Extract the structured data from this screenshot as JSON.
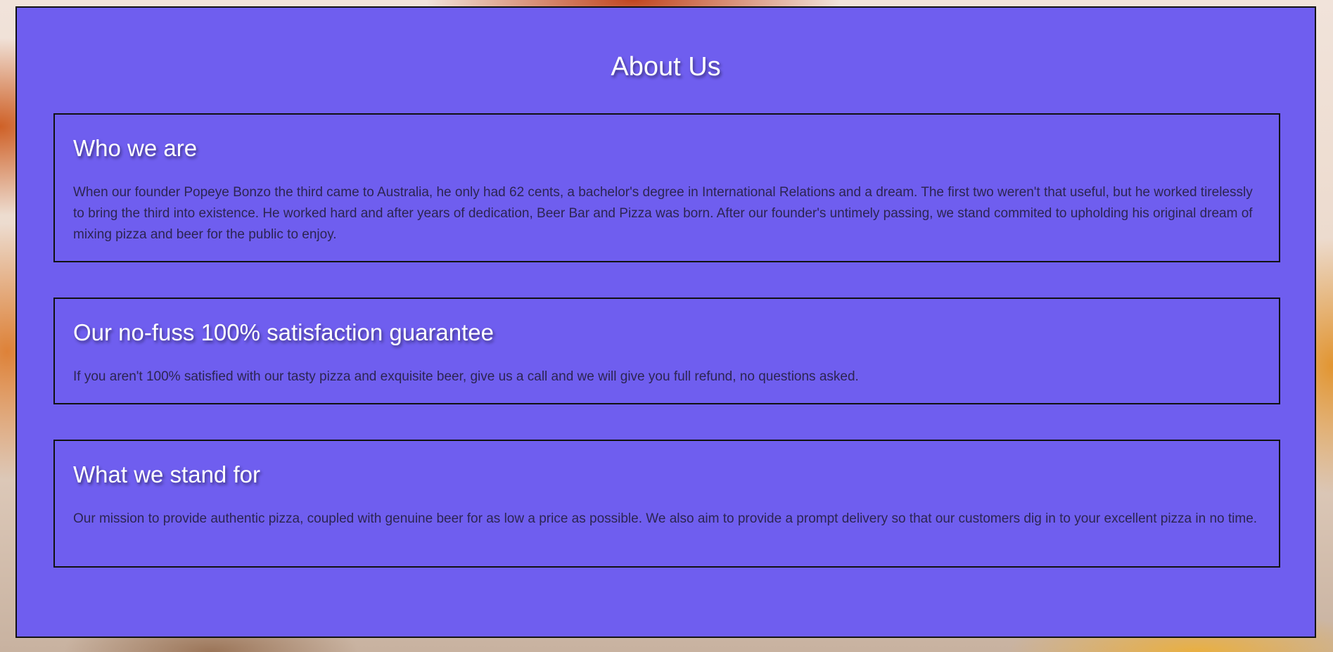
{
  "page": {
    "title": "About Us"
  },
  "sections": [
    {
      "heading": "Who we are",
      "text": "When our founder Popeye Bonzo the third came to Australia, he only had 62 cents, a bachelor's degree in International Relations and a dream. The first two weren't that useful, but he worked tirelessly to bring the third into existence. He worked hard and after years of dedication, Beer Bar and Pizza was born. After our founder's untimely passing, we stand commited to upholding his original dream of mixing pizza and beer for the public to enjoy."
    },
    {
      "heading": "Our no-fuss 100% satisfaction guarantee",
      "text": "If you aren't 100% satisfied with our tasty pizza and exquisite beer, give us a call and we will give you full refund, no questions asked."
    },
    {
      "heading": "What we stand for",
      "text": "Our mission to provide authentic pizza, coupled with genuine beer for as low a price as possible. We also aim to provide a prompt delivery so that our customers dig in to your excellent pizza in no time."
    }
  ],
  "colors": {
    "panel_background": "#6f5eef",
    "heading_text": "#ffffff",
    "body_text": "#2c2552",
    "border": "#111111"
  }
}
